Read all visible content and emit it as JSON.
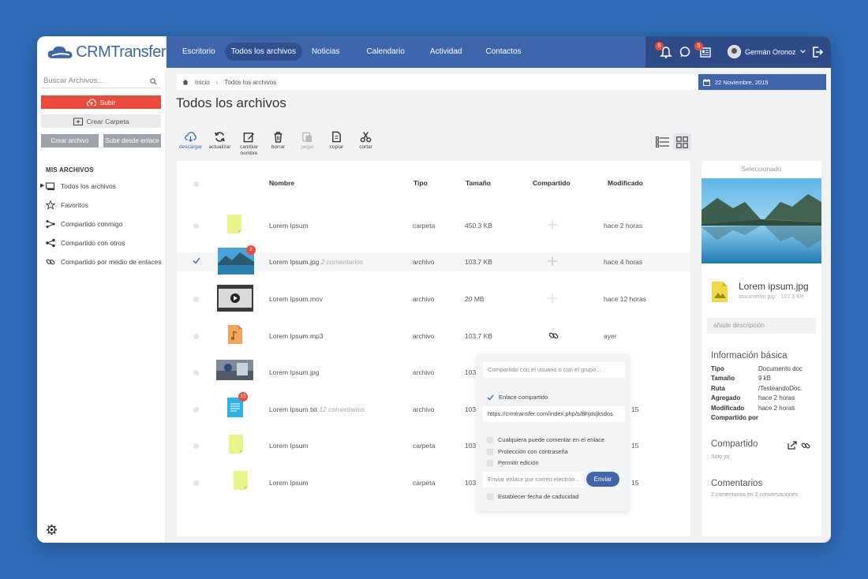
{
  "app": {
    "logo_text": "CRMTransfer"
  },
  "nav": {
    "items": [
      "Escritorio",
      "Todos los archivos",
      "Noticias",
      "Calendario",
      "Actividad",
      "Contactos"
    ],
    "active_index": 1
  },
  "notifications": {
    "alerts_count": "6",
    "tasks_count": "5"
  },
  "user": {
    "name": "Germán Oronoz"
  },
  "sidebar": {
    "search_placeholder": "Buscar Archivos...",
    "upload_label": "Subir",
    "create_folder_label": "Crear Carpeta",
    "create_file_label": "Crear archivo",
    "upload_link_label": "Subir desde enlace",
    "section_title": "MIS ARCHIVOS",
    "items": [
      {
        "label": "Todos los archivos",
        "icon": "monitor-icon"
      },
      {
        "label": "Favoritos",
        "icon": "star-icon"
      },
      {
        "label": "Compartido conmigo",
        "icon": "share-in-icon"
      },
      {
        "label": "Compartido con otros",
        "icon": "share-icon"
      },
      {
        "label": "Compartido por medio de enlaces",
        "icon": "link-icon"
      }
    ]
  },
  "breadcrumb": {
    "home": "Inicio",
    "current": "Todos los archivos"
  },
  "date": "22 Noviembre, 2015",
  "page_title": "Todos los archivos",
  "toolbar": [
    {
      "label": "descargar"
    },
    {
      "label": "actualizar"
    },
    {
      "label": "cambiar nombre"
    },
    {
      "label": "borrar"
    },
    {
      "label": "pegar"
    },
    {
      "label": "copiar"
    },
    {
      "label": "cortar"
    }
  ],
  "table": {
    "headers": {
      "name": "Nombre",
      "type": "Tipo",
      "size": "Tamaño",
      "shared": "Compartido",
      "modified": "Modificado"
    },
    "rows": [
      {
        "name": "Lorem Ipsum",
        "comments": "",
        "type": "carpeta",
        "size": "450.3 KB",
        "modified": "hace 2 horas",
        "shared": "plus"
      },
      {
        "name": "Lorem Ipsum.jpg",
        "comments": "2 comentarios",
        "type": "archivo",
        "size": "103.7 KB",
        "modified": "hace 4 horas",
        "shared": "plus",
        "badge": "2"
      },
      {
        "name": "Lorem Ipsum.mov",
        "comments": "",
        "type": "archivo",
        "size": "20 MB",
        "modified": "hace 12 horas",
        "shared": "plus"
      },
      {
        "name": "Lorem Ipsum.mp3",
        "comments": "",
        "type": "archivo",
        "size": "103.7 KB",
        "modified": "ayer",
        "shared": "link"
      },
      {
        "name": "Lorem Ipsum.jpg",
        "comments": "",
        "type": "archivo",
        "size": "103",
        "modified": "",
        "shared": ""
      },
      {
        "name": "Lorem Ipsum.txt",
        "comments": "12 comentarios",
        "type": "archivo",
        "size": "103",
        "modified": "15",
        "shared": "",
        "badge": "12"
      },
      {
        "name": "Lorem Ipsum",
        "comments": "",
        "type": "carpeta",
        "size": "103",
        "modified": "15",
        "shared": ""
      },
      {
        "name": "Lorem Ipsum",
        "comments": "",
        "type": "carpeta",
        "size": "103",
        "modified": "15",
        "shared": ""
      }
    ]
  },
  "share_popup": {
    "user_placeholder": "Compartido con el usuario o con el grupo...",
    "link_shared_label": "Enlace compartido",
    "link_url": "https://crmtransfer.com/index.php/s/Bhjdsjksdos",
    "options": [
      "Cualquiera puede comentar en el enlace",
      "Protección con contraseña",
      "Permitir edición"
    ],
    "email_placeholder": "Enviar enlace por correo electrón...",
    "send_label": "Enviar",
    "expiry_label": "Establecer fecha de caducidad"
  },
  "details": {
    "header": "Seleccionado",
    "file_name": "Lorem ipsum.jpg",
    "file_type": "documento jpg",
    "file_size": "107.3 KB",
    "description_placeholder": "añade descripción",
    "basic_title": "Información básica",
    "basic": [
      {
        "key": "Tipo",
        "value": "Documento doc"
      },
      {
        "key": "Tamaño",
        "value": "9 kB"
      },
      {
        "key": "Ruta",
        "value": "/TesteandoDoc."
      },
      {
        "key": "Agregado",
        "value": "hace 2 horas"
      },
      {
        "key": "Modificado",
        "value": "hace 2 horas"
      },
      {
        "key": "Compartido por",
        "value": ""
      }
    ],
    "shared_title": "Compartido",
    "shared_sub": "Sólo yo",
    "comments_title": "Comentarios",
    "comments_sub": "2 comentarios en 2 conversaciones"
  },
  "colors": {
    "accent": "#3f66ad",
    "danger": "#e94b3c",
    "background": "#2f6bb7"
  }
}
